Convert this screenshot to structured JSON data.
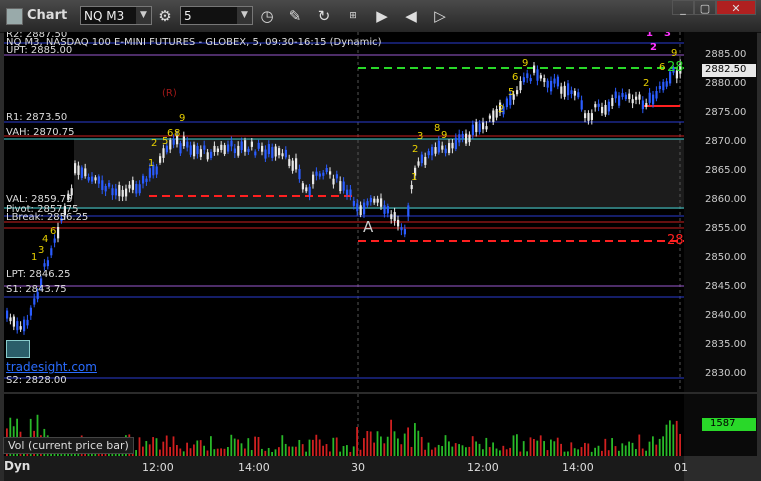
{
  "window": {
    "title": "Chart"
  },
  "toolbar": {
    "symbol": "NQ M3",
    "interval": "5",
    "icons": [
      "gear-icon",
      "clock-icon",
      "pencil-icon",
      "refresh-icon",
      "settings-icon",
      "play-icon",
      "back-icon",
      "forward-icon"
    ]
  },
  "chart_info": {
    "line": "NQ M3, NASDAQ 100 E-MINI FUTURES - GLOBEX, 5, 09:30-16:15 (Dynamic)"
  },
  "levels": {
    "r2": "R2: 2887.50",
    "upt": "UPT: 2885.00",
    "r1": "R1: 2873.50",
    "vah": "VAH: 2870.75",
    "val": "VAL: 2859.75",
    "pivot": "Pivot: 2857.75",
    "lbreak": "LBreak: 2856.25",
    "lpt": "LPT: 2846.25",
    "s1": "S1: 2843.75",
    "s2": "S2: 2828.00"
  },
  "annotations": {
    "r_marker": "(R)",
    "a_marker": "A",
    "watermark": "tradesight.com",
    "right_green": "28",
    "right_red": "28"
  },
  "y_axis": [
    "2885.00",
    "2880.00",
    "2875.00",
    "2870.00",
    "2865.00",
    "2860.00",
    "2855.00",
    "2850.00",
    "2845.00",
    "2840.00",
    "2835.00",
    "2830.00"
  ],
  "price_badge": "2882.50",
  "volume": {
    "label": "Vol (current price bar)",
    "badge": "1587"
  },
  "x_axis": [
    "12:00",
    "14:00",
    "30",
    "12:00",
    "14:00",
    "01"
  ],
  "bottom_left": "Dyn",
  "colors": {
    "bull": "#e8e8e8",
    "bear": "#2a5cff",
    "green": "#29d829",
    "red": "#ff2020"
  }
}
